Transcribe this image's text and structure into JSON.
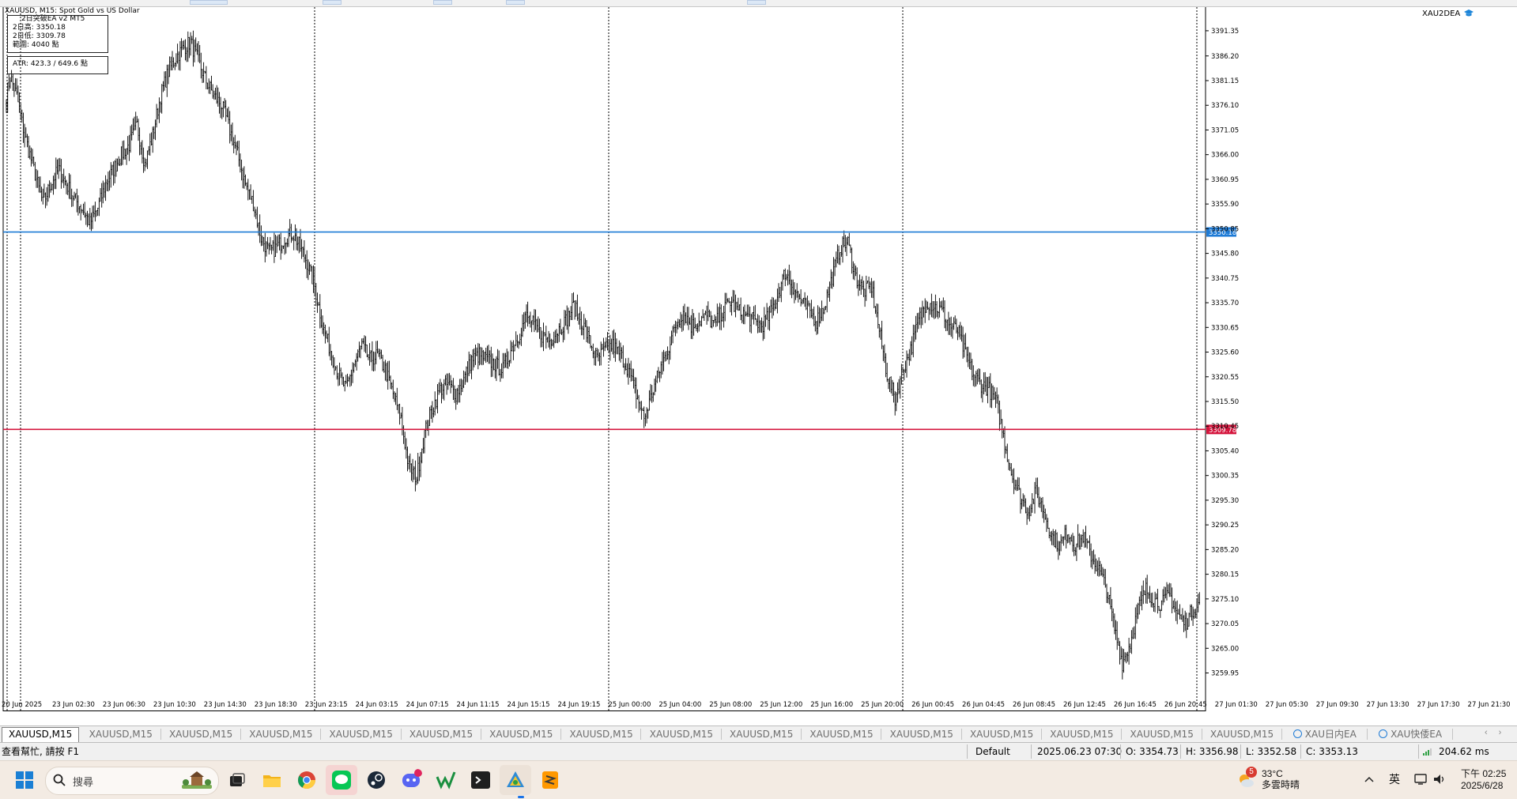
{
  "chart_data": {
    "type": "candlestick",
    "symbol_title": "XAUUSD, M15:  Spot Gold vs US Dollar",
    "indicator_name": "2日突破EA v2 MT5",
    "info_lines": [
      "2日高: 3350.18",
      "2日低: 3309.78",
      "範圍: 4040 點"
    ],
    "atr_line": "ATR: 423.3 / 649.6 點",
    "ea_label": "XAU2DEA",
    "ylim": [
      3256.8,
      3393.6
    ],
    "y_ticks": [
      "3391.35",
      "3386.20",
      "3381.15",
      "3376.10",
      "3371.05",
      "3366.00",
      "3360.95",
      "3355.90",
      "3350.85",
      "3345.80",
      "3340.75",
      "3335.70",
      "3330.65",
      "3325.60",
      "3320.55",
      "3315.50",
      "3310.45",
      "3305.40",
      "3300.35",
      "3295.30",
      "3290.25",
      "3285.20",
      "3280.15",
      "3275.10",
      "3270.05",
      "3265.00",
      "3259.95"
    ],
    "x_ticks": [
      "20 Jun 2025",
      "23 Jun 02:30",
      "23 Jun 06:30",
      "23 Jun 10:30",
      "23 Jun 14:30",
      "23 Jun 18:30",
      "23 Jun 23:15",
      "24 Jun 03:15",
      "24 Jun 07:15",
      "24 Jun 11:15",
      "24 Jun 15:15",
      "24 Jun 19:15",
      "25 Jun 00:00",
      "25 Jun 04:00",
      "25 Jun 08:00",
      "25 Jun 12:00",
      "25 Jun 16:00",
      "25 Jun 20:00",
      "26 Jun 00:45",
      "26 Jun 04:45",
      "26 Jun 08:45",
      "26 Jun 12:45",
      "26 Jun 16:45",
      "26 Jun 20:45",
      "27 Jun 01:30",
      "27 Jun 05:30",
      "27 Jun 09:30",
      "27 Jun 13:30",
      "27 Jun 17:30",
      "27 Jun 21:30"
    ],
    "high_line": {
      "value": 3350.18,
      "label": "3350.18",
      "color": "#1e7bd6"
    },
    "low_line": {
      "value": 3309.78,
      "label": "3309.78",
      "color": "#d4143c"
    },
    "close_anchors": [
      [
        0,
        3378
      ],
      [
        3,
        3382
      ],
      [
        8,
        3378
      ],
      [
        14,
        3370
      ],
      [
        22,
        3362
      ],
      [
        28,
        3356
      ],
      [
        34,
        3360
      ],
      [
        40,
        3363
      ],
      [
        46,
        3360
      ],
      [
        52,
        3357
      ],
      [
        58,
        3355
      ],
      [
        64,
        3352
      ],
      [
        70,
        3355
      ],
      [
        76,
        3360
      ],
      [
        82,
        3363
      ],
      [
        88,
        3366
      ],
      [
        94,
        3368
      ],
      [
        100,
        3372
      ],
      [
        106,
        3364
      ],
      [
        112,
        3370
      ],
      [
        118,
        3378
      ],
      [
        124,
        3383
      ],
      [
        130,
        3386
      ],
      [
        136,
        3388
      ],
      [
        141,
        3389
      ],
      [
        147,
        3385
      ],
      [
        153,
        3381
      ],
      [
        159,
        3378
      ],
      [
        165,
        3376
      ],
      [
        171,
        3371
      ],
      [
        177,
        3366
      ],
      [
        183,
        3360
      ],
      [
        189,
        3356
      ],
      [
        195,
        3349
      ],
      [
        201,
        3346
      ],
      [
        207,
        3347
      ],
      [
        213,
        3349
      ],
      [
        219,
        3350
      ],
      [
        225,
        3347
      ],
      [
        230,
        3344
      ],
      [
        236,
        3339
      ],
      [
        242,
        3331
      ],
      [
        248,
        3326
      ],
      [
        254,
        3321
      ],
      [
        260,
        3318
      ],
      [
        266,
        3323
      ],
      [
        272,
        3327
      ],
      [
        278,
        3324
      ],
      [
        284,
        3325
      ],
      [
        290,
        3322
      ],
      [
        296,
        3317
      ],
      [
        302,
        3312
      ],
      [
        308,
        3302
      ],
      [
        314,
        3300
      ],
      [
        320,
        3309
      ],
      [
        326,
        3314
      ],
      [
        332,
        3318
      ],
      [
        338,
        3319
      ],
      [
        344,
        3317
      ],
      [
        350,
        3320
      ],
      [
        356,
        3324
      ],
      [
        362,
        3325
      ],
      [
        368,
        3324
      ],
      [
        374,
        3323
      ],
      [
        380,
        3322
      ],
      [
        386,
        3326
      ],
      [
        392,
        3329
      ],
      [
        398,
        3333
      ],
      [
        404,
        3331
      ],
      [
        410,
        3329
      ],
      [
        416,
        3328
      ],
      [
        422,
        3330
      ],
      [
        428,
        3332
      ],
      [
        434,
        3335
      ],
      [
        440,
        3332
      ],
      [
        446,
        3328
      ],
      [
        452,
        3324
      ],
      [
        458,
        3326
      ],
      [
        464,
        3327
      ],
      [
        470,
        3325
      ],
      [
        476,
        3322
      ],
      [
        482,
        3317
      ],
      [
        488,
        3312
      ],
      [
        494,
        3317
      ],
      [
        500,
        3322
      ],
      [
        506,
        3326
      ],
      [
        512,
        3331
      ],
      [
        518,
        3334
      ],
      [
        524,
        3331
      ],
      [
        530,
        3332
      ],
      [
        536,
        3333
      ],
      [
        542,
        3331
      ],
      [
        548,
        3334
      ],
      [
        554,
        3336
      ],
      [
        560,
        3334
      ],
      [
        566,
        3333
      ],
      [
        572,
        3332
      ],
      [
        578,
        3331
      ],
      [
        584,
        3333
      ],
      [
        590,
        3337
      ],
      [
        596,
        3342
      ],
      [
        602,
        3339
      ],
      [
        608,
        3336
      ],
      [
        614,
        3334
      ],
      [
        620,
        3332
      ],
      [
        626,
        3335
      ],
      [
        632,
        3341
      ],
      [
        638,
        3347
      ],
      [
        644,
        3348
      ],
      [
        650,
        3341
      ],
      [
        656,
        3338
      ],
      [
        662,
        3339
      ],
      [
        668,
        3330
      ],
      [
        674,
        3321
      ],
      [
        680,
        3316
      ],
      [
        686,
        3322
      ],
      [
        692,
        3326
      ],
      [
        698,
        3332
      ],
      [
        704,
        3336
      ],
      [
        710,
        3335
      ],
      [
        716,
        3334
      ],
      [
        722,
        3331
      ],
      [
        728,
        3330
      ],
      [
        734,
        3325
      ],
      [
        740,
        3321
      ],
      [
        746,
        3319
      ],
      [
        752,
        3318
      ],
      [
        758,
        3315
      ],
      [
        764,
        3307
      ],
      [
        770,
        3300
      ],
      [
        776,
        3296
      ],
      [
        782,
        3293
      ],
      [
        788,
        3297
      ],
      [
        794,
        3293
      ],
      [
        800,
        3288
      ],
      [
        806,
        3286
      ],
      [
        812,
        3289
      ],
      [
        818,
        3286
      ],
      [
        824,
        3288
      ],
      [
        830,
        3284
      ],
      [
        836,
        3281
      ],
      [
        842,
        3277
      ],
      [
        848,
        3269
      ],
      [
        854,
        3262
      ],
      [
        860,
        3266
      ],
      [
        866,
        3273
      ],
      [
        872,
        3277
      ],
      [
        878,
        3275
      ],
      [
        884,
        3274
      ],
      [
        890,
        3276
      ],
      [
        896,
        3272
      ],
      [
        902,
        3270
      ],
      [
        908,
        3273
      ],
      [
        913,
        3274
      ]
    ],
    "candle_count": 914
  },
  "tabs": [
    "XAUUSD,M15",
    "XAUUSD,M15",
    "XAUUSD,M15",
    "XAUUSD,M15",
    "XAUUSD,M15",
    "XAUUSD,M15",
    "XAUUSD,M15",
    "XAUUSD,M15",
    "XAUUSD,M15",
    "XAUUSD,M15",
    "XAUUSD,M15",
    "XAUUSD,M15",
    "XAUUSD,M15",
    "XAUUSD,M15",
    "XAUUSD,M15",
    "XAUUSD,M15",
    "XAU日内EA",
    "XAU快倭EA"
  ],
  "status": {
    "help": "查看幫忙, 請按 F1",
    "profile": "Default",
    "datetime": "2025.06.23 07:30",
    "open": "O: 3354.73",
    "high": "H: 3356.98",
    "low": "L: 3352.58",
    "close": "C: 3353.13",
    "ping": "204.62 ms"
  },
  "taskbar": {
    "search_placeholder": "搜尋",
    "weather_badge": "5",
    "temperature": "33°C",
    "weather_desc": "多雲時晴",
    "ime": "英",
    "time": "下午 02:25",
    "date": "2025/6/28"
  },
  "colors": {
    "candle": "#000000",
    "high_line": "#1e7bd6",
    "low_line": "#d4143c",
    "separator": "#000000"
  }
}
